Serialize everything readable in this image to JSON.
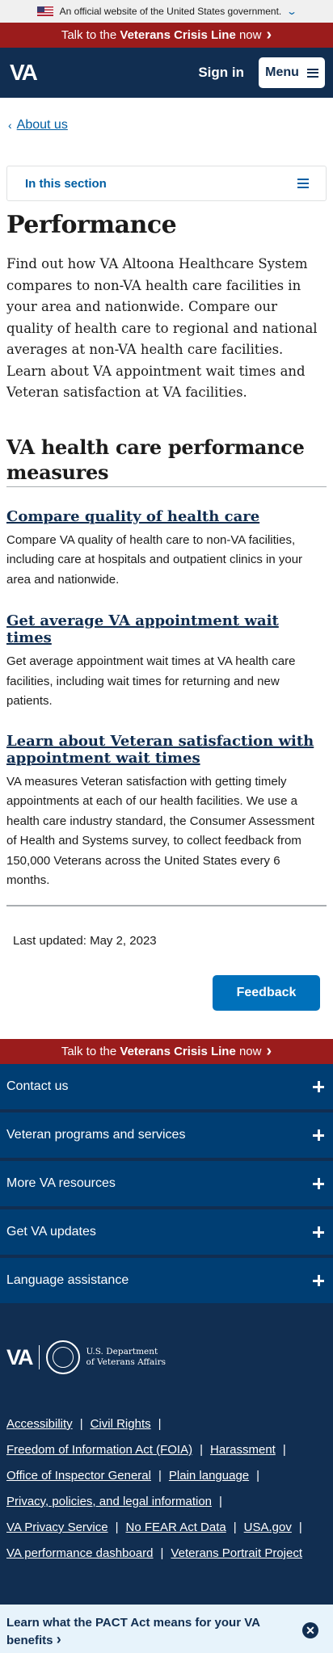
{
  "gov_banner": {
    "text": "An official website of the United States government.",
    "chevron": "chevron-down-icon"
  },
  "crisis_line": {
    "prefix": "Talk to the ",
    "emphasis": "Veterans Crisis Line",
    "suffix": " now",
    "arrow": "›"
  },
  "header": {
    "logo": "VA",
    "sign_in": "Sign in",
    "menu_label": "Menu"
  },
  "breadcrumb": {
    "chevron": "‹",
    "label": "About us"
  },
  "section_nav": {
    "label": "In this section"
  },
  "page": {
    "title": "Performance",
    "intro": "Find out how VA Altoona Healthcare System compares to non-VA health care facilities in your area and nationwide. Compare our quality of health care to regional and national averages at non-VA health care facilities. Learn about VA appointment wait times and Veteran satisfaction at VA facilities.",
    "section_heading": "VA health care performance measures",
    "measures": [
      {
        "title": "Compare quality of health care",
        "description": "Compare VA quality of health care to non-VA facilities, including care at hospitals and outpatient clinics in your area and nationwide."
      },
      {
        "title": "Get average VA appointment wait times",
        "description": "Get average appointment wait times at VA health care facilities, including wait times for returning and new patients."
      },
      {
        "title": "Learn about Veteran satisfaction with appointment wait times",
        "description": "VA measures Veteran satisfaction with getting timely appointments at each of our health facilities. We use a health care industry standard, the Consumer Assessment of Health and Systems survey, to collect feedback from 150,000 Veterans across the United States every 6 months."
      }
    ],
    "last_updated": "Last updated: May 2, 2023",
    "feedback": "Feedback"
  },
  "footer": {
    "accordion": [
      "Contact us",
      "Veteran programs and services",
      "More VA resources",
      "Get VA updates",
      "Language assistance"
    ],
    "logo": "VA",
    "dept_line1": "U.S. Department",
    "dept_line2": "of Veterans Affairs",
    "links": [
      "Accessibility",
      "Civil Rights",
      "Freedom of Information Act (FOIA)",
      "Harassment",
      "Office of Inspector General",
      "Plain language",
      "Privacy, policies, and legal information",
      "VA Privacy Service",
      "No FEAR Act Data",
      "USA.gov",
      "VA performance dashboard",
      "Veterans Portrait Project"
    ],
    "pipe": "|"
  },
  "pact_banner": {
    "text": "Learn what the PACT Act means for your VA benefits",
    "arrow": "›",
    "close": "✕"
  }
}
